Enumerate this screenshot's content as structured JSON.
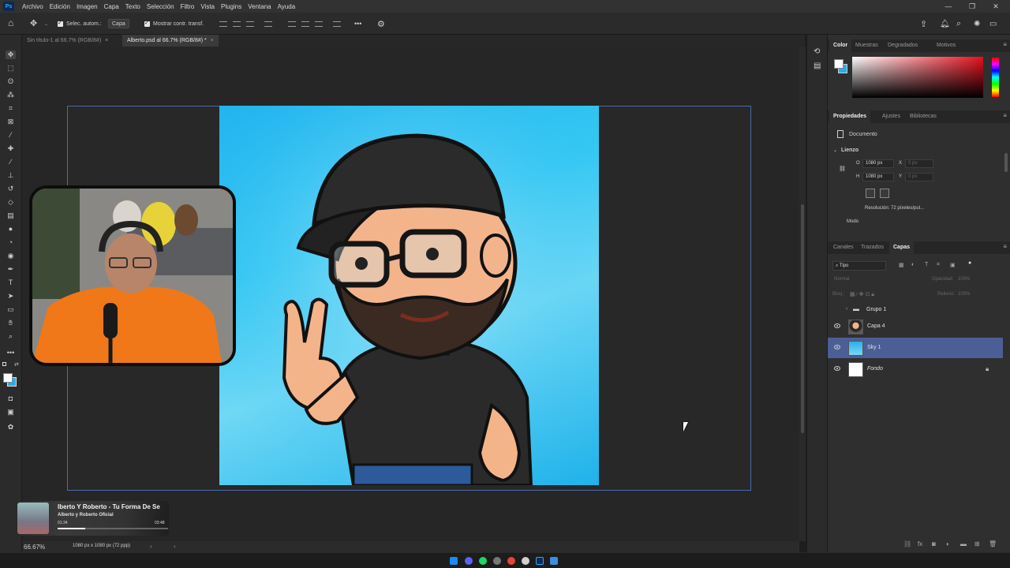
{
  "menubar": {
    "logo": "Ps",
    "items": [
      "Archivo",
      "Edición",
      "Imagen",
      "Capa",
      "Texto",
      "Selección",
      "Filtro",
      "Vista",
      "Plugins",
      "Ventana",
      "Ayuda"
    ]
  },
  "options": {
    "auto_select_label": "Selec. autom.:",
    "auto_select_value": "Capa",
    "show_transform_label": "Mostrar contr. transf.",
    "more": "•••"
  },
  "tabs": [
    {
      "label": "Sin título-1 al 66.7% (RGB/8#)",
      "close": "×"
    },
    {
      "label": "Alberto.psd al 66.7% (RGB/8#) *",
      "close": "×"
    }
  ],
  "music_widget": {
    "title": "lberto Y Roberto - Tu Forma De Se",
    "artist": "Alberto y Roberto Oficial",
    "elapsed": "01:34",
    "duration": "03:48",
    "progress": 0.25
  },
  "status": {
    "zoom": "66.67%",
    "doc_info": "1080 px x 1080 px (72 ppp)"
  },
  "color_panel": {
    "tabs": [
      "Color",
      "Muestras",
      "Degradados",
      "Motivos"
    ],
    "active_tab": "Color",
    "menu": "≡"
  },
  "properties_panel": {
    "tabs": [
      "Propiedades",
      "Ajustes",
      "Bibliotecas"
    ],
    "active_tab": "Propiedades",
    "menu": "≡",
    "doc_label": "Documento",
    "section": "Lienzo",
    "width_label": "O",
    "width_value": "1080 px",
    "height_label": "H",
    "height_value": "1080 px",
    "x_label": "X",
    "x_value": "0 px",
    "y_label": "Y",
    "y_value": "0 px",
    "resolution": "Resolución: 72 píxeles/pul...",
    "mode_label": "Modo"
  },
  "layers_panel": {
    "tabs": [
      "Canales",
      "Trazados",
      "Capas"
    ],
    "active_tab": "Capas",
    "menu": "≡",
    "filter_label": "Tipo",
    "blend_mode": "Normal",
    "opacity_label": "Opacidad:",
    "opacity_value": "100%",
    "lock_label": "Bloq.:",
    "fill_label": "Relleno:",
    "fill_value": "100%",
    "layers": [
      {
        "name": "Grupo 1",
        "visible": false,
        "kind": "group"
      },
      {
        "name": "Capa 4",
        "visible": true,
        "kind": "image"
      },
      {
        "name": "Sky 1",
        "visible": true,
        "kind": "sky",
        "selected": true
      },
      {
        "name": "Fondo",
        "visible": true,
        "kind": "background",
        "locked": true
      }
    ]
  },
  "colors": {
    "accent_selection": "#4b5f96",
    "canvas_sky": "#2fbef0",
    "doc_border": "#4a6aa8"
  }
}
